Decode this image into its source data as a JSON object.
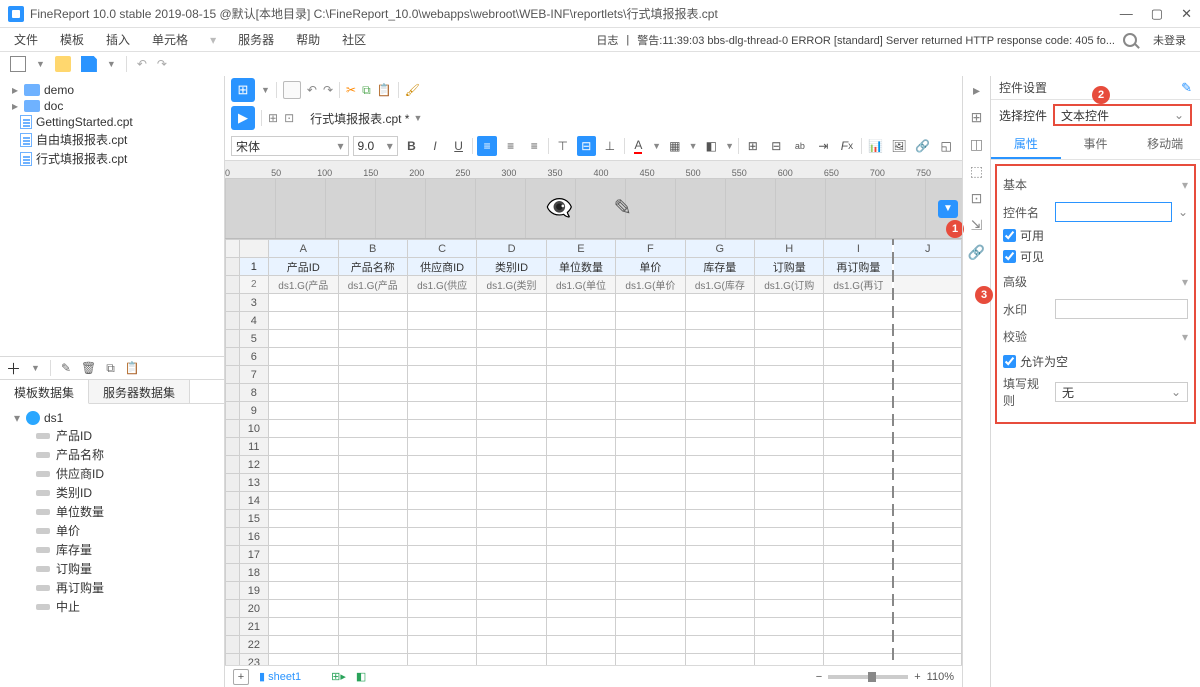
{
  "title": "FineReport 10.0 stable 2019-08-15  @默认[本地目录]    C:\\FineReport_10.0\\webapps\\webroot\\WEB-INF\\reportlets\\行式填报报表.cpt",
  "menu": [
    "文件",
    "模板",
    "插入",
    "单元格",
    "服务器",
    "帮助",
    "社区"
  ],
  "log_label": "日志",
  "log_text": "警告:11:39:03 bbs-dlg-thread-0 ERROR [standard] Server returned HTTP response code: 405 fo...",
  "login_status": "未登录",
  "file_tree": {
    "folders": [
      "demo",
      "doc"
    ],
    "files": [
      "GettingStarted.cpt",
      "自由填报报表.cpt",
      "行式填报报表.cpt"
    ]
  },
  "ds_tabs": [
    "模板数据集",
    "服务器数据集"
  ],
  "ds_name": "ds1",
  "ds_columns": [
    "产品ID",
    "产品名称",
    "供应商ID",
    "类别ID",
    "单位数量",
    "单价",
    "库存量",
    "订购量",
    "再订购量",
    "中止"
  ],
  "open_tab": "行式填报报表.cpt *",
  "font_name": "宋体",
  "font_size": "9.0",
  "ruler_ticks": [
    "0",
    "50",
    "100",
    "150",
    "200",
    "250",
    "300",
    "350",
    "400",
    "450",
    "500",
    "550",
    "600",
    "650",
    "700",
    "750"
  ],
  "columns": [
    "A",
    "B",
    "C",
    "D",
    "E",
    "F",
    "G",
    "H",
    "I",
    "J"
  ],
  "header_row": [
    "产品ID",
    "产品名称",
    "供应商ID",
    "类别ID",
    "单位数量",
    "单价",
    "库存量",
    "订购量",
    "再订购量",
    ""
  ],
  "data_row": [
    "ds1.G(产品",
    "ds1.G(产品",
    "ds1.G(供应",
    "ds1.G(类别",
    "ds1.G(单位",
    "ds1.G(单价",
    "ds1.G(库存",
    "ds1.G(订购",
    "ds1.G(再订",
    ""
  ],
  "row_count": 23,
  "sheet_name": "sheet1",
  "zoom_text": "110%",
  "right": {
    "panel_title": "控件设置",
    "select_label": "选择控件",
    "select_value": "文本控件",
    "tabs": [
      "属性",
      "事件",
      "移动端"
    ],
    "sec_basic": "基本",
    "fld_name": "控件名",
    "chk_enable": "可用",
    "chk_visible": "可见",
    "sec_adv": "高级",
    "fld_watermark": "水印",
    "sec_valid": "校验",
    "chk_allow_empty": "允许为空",
    "fld_rule": "填写规则",
    "rule_value": "无"
  },
  "badges": {
    "1": "1",
    "2": "2",
    "3": "3"
  }
}
